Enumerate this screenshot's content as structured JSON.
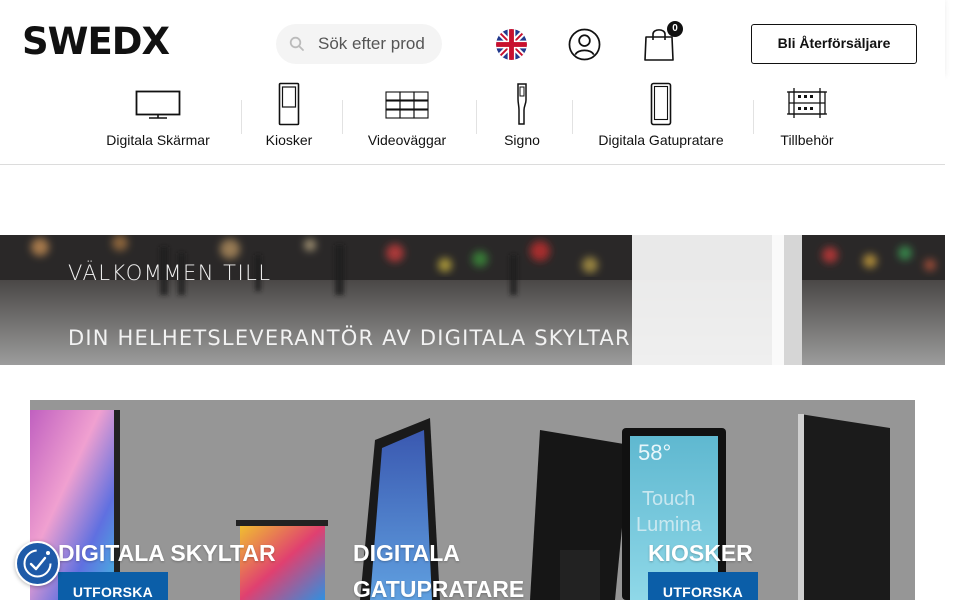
{
  "header": {
    "logo_text": "SWEDX",
    "search": {
      "placeholder": "Sök efter prod"
    },
    "language_icon": "uk-flag-icon",
    "account_icon": "user-icon",
    "cart_icon": "shopping-bag-icon",
    "cart_count": "0",
    "reseller_button": "Bli Återförsäljare"
  },
  "categories": [
    {
      "label": "Digitala Skärmar",
      "icon": "monitor-icon"
    },
    {
      "label": "Kiosker",
      "icon": "kiosk-icon"
    },
    {
      "label": "Videoväggar",
      "icon": "video-wall-icon"
    },
    {
      "label": "Signo",
      "icon": "signo-stand-icon"
    },
    {
      "label": "Digitala Gatupratare",
      "icon": "street-sign-icon"
    },
    {
      "label": "Tillbehör",
      "icon": "mount-bracket-icon"
    }
  ],
  "hero": {
    "title": "VÄLKOMMEN TILL",
    "subtitle": "DIN HELHETSLEVERANTÖR AV DIGITALA SKYLTAR"
  },
  "banner": {
    "cards": [
      {
        "title": "DIGITALA SKYLTAR",
        "button": "UTFORSKA"
      },
      {
        "title_line1": "DIGITALA",
        "title_line2": "GATUPRATARE"
      },
      {
        "title": "KIOSKER",
        "button": "UTFORSKA"
      }
    ],
    "kiosk_screen_text_1": "58°",
    "kiosk_screen_text_2": "Touch",
    "kiosk_screen_text_3": "Lumina"
  },
  "accessibility_icon": "accessibility-icon",
  "colors": {
    "accent": "#0b5ea8",
    "text": "#111111",
    "a11y": "#1e5aa8"
  }
}
